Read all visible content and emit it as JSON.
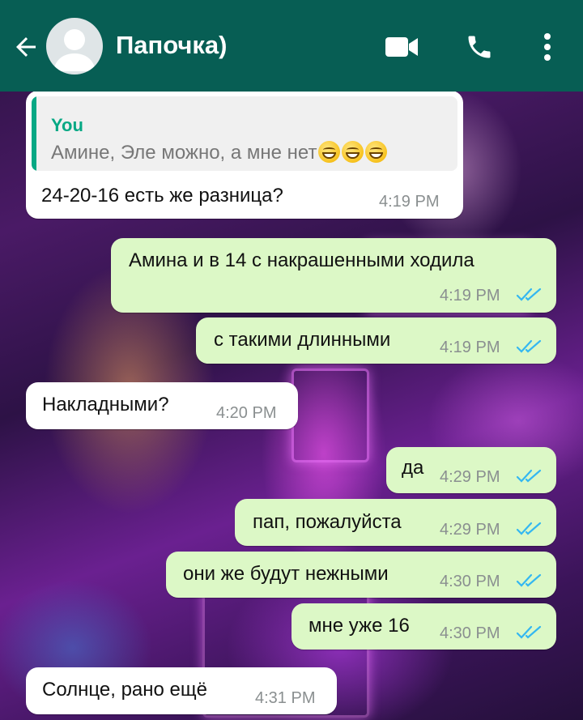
{
  "header": {
    "contact_name": "Папочка)",
    "back_icon": "arrow-left-icon",
    "avatar_icon": "default-avatar-icon",
    "video_icon": "video-camera-icon",
    "call_icon": "phone-icon",
    "menu_icon": "more-vertical-icon",
    "color": "#075e54"
  },
  "colors": {
    "incoming": "#ffffff",
    "outgoing": "#dcf8c6",
    "quote_accent": "#06a884",
    "read_ticks": "#34b7f1"
  },
  "messages": [
    {
      "direction": "incoming",
      "reply_to": {
        "author": "You",
        "text": "Амине, Эле можно, а мне нет"
      },
      "text": "24-20-16 есть же разница?",
      "time": "4:19 PM"
    },
    {
      "direction": "outgoing",
      "text": "Амина и в 14 с накрашенными ходила",
      "time": "4:19 PM",
      "status": "read"
    },
    {
      "direction": "outgoing",
      "text": "с такими длинными",
      "time": "4:19 PM",
      "status": "read"
    },
    {
      "direction": "incoming",
      "text": "Накладными?",
      "time": "4:20 PM"
    },
    {
      "direction": "outgoing",
      "text": "да",
      "time": "4:29 PM",
      "status": "read"
    },
    {
      "direction": "outgoing",
      "text": "пап, пожалуйста",
      "time": "4:29 PM",
      "status": "read"
    },
    {
      "direction": "outgoing",
      "text": "они же будут нежными",
      "time": "4:30 PM",
      "status": "read"
    },
    {
      "direction": "outgoing",
      "text": "мне уже 16",
      "time": "4:30 PM",
      "status": "read"
    },
    {
      "direction": "incoming",
      "text": "Солнце, рано ещё",
      "time": "4:31 PM"
    }
  ]
}
